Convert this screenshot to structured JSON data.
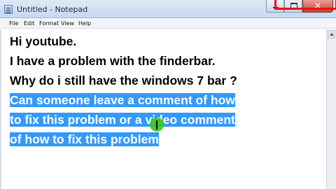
{
  "window": {
    "title": "Untitled - Notepad",
    "close_glyph": "✕",
    "accent_color": "#3399ff",
    "highlight_frame_color": "#e8101a"
  },
  "menu": {
    "items": [
      "File",
      "Edit",
      "Format",
      "View",
      "Help"
    ]
  },
  "editor": {
    "lines": [
      "Hi youtube.",
      "I have a problem with the finderbar.",
      "Why do i still have the windows 7 bar ?",
      "Can someone leave a comment of how",
      "to fix this problem or a video comment",
      "of how to fix this problem"
    ],
    "selected_line_indices": [
      3,
      4,
      5
    ]
  },
  "icons": {
    "app": "notepad-icon",
    "minimize": "minimize-icon",
    "maximize": "maximize-icon",
    "close": "close-icon",
    "scroll_up": "scroll-up-arrow-icon",
    "mouse": "mouse-cursor-highlight-icon"
  }
}
